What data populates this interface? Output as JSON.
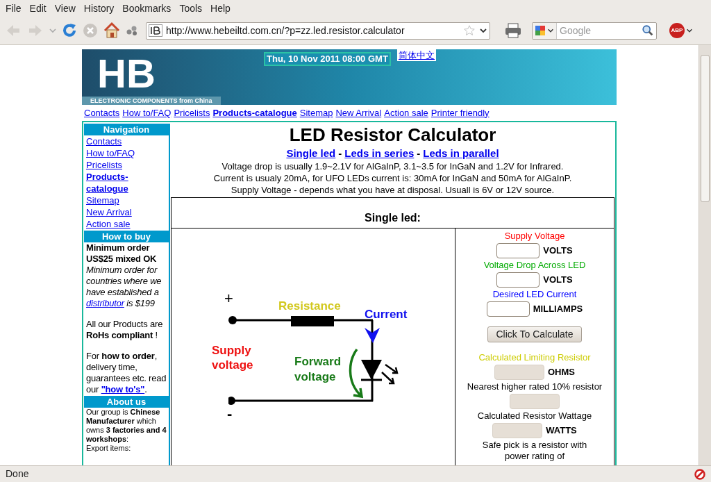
{
  "menu": [
    {
      "label": "File"
    },
    {
      "label": "Edit"
    },
    {
      "label": "View"
    },
    {
      "label": "History"
    },
    {
      "label": "Bookmarks"
    },
    {
      "label": "Tools"
    },
    {
      "label": "Help"
    }
  ],
  "toolbar": {
    "url": "http://www.hebeiltd.com.cn/?p=zz.led.resistor.calculator",
    "search": {
      "placeholder": "Google"
    },
    "adblock_label": "ABP"
  },
  "banner": {
    "logo": "HB",
    "tagline": "ELECTRONIC COMPONENTS from China",
    "date": "Thu, 10 Nov 2011 08:00 GMT",
    "language_link": "简体中文"
  },
  "top_links": [
    {
      "label": "Contacts",
      "bold": false
    },
    {
      "label": "How to/FAQ",
      "bold": false
    },
    {
      "label": "Pricelists",
      "bold": false
    },
    {
      "label": "Products-catalogue",
      "bold": true
    },
    {
      "label": "Sitemap",
      "bold": false
    },
    {
      "label": "New Arrival",
      "bold": false
    },
    {
      "label": "Action sale",
      "bold": false
    },
    {
      "label": "Printer friendly",
      "bold": false
    }
  ],
  "sidebar": {
    "navigation": {
      "title": "Navigation",
      "items": [
        {
          "label": "Contacts",
          "bold": false
        },
        {
          "label": "How to/FAQ",
          "bold": false
        },
        {
          "label": "Pricelists",
          "bold": false
        },
        {
          "label": "Products-catalogue",
          "bold": true
        },
        {
          "label": "Sitemap",
          "bold": false
        },
        {
          "label": "New Arrival",
          "bold": false
        },
        {
          "label": "Action sale",
          "bold": false
        }
      ]
    },
    "how_to_buy": {
      "title": "How to buy",
      "headline": "Minimum order US$25 mixed OK",
      "paragraphs": [
        {
          "before": "Minimum order for countries where we have established a",
          "link": "distributor",
          "after": "is $199",
          "italic": true
        },
        {
          "before": "All our Products are **RoHs compliant** !",
          "italic": false
        },
        {
          "before": "For **how to order**, delivery time, guarantees etc. read our",
          "link": "\"how to's\"",
          "after": ".",
          "italic": false
        }
      ]
    },
    "about_us": {
      "title": "About us",
      "paragraphs": [
        "Our group is **Chinese Manufacturer** which owns **3 factories and 4 workshops**:",
        "Export items:"
      ]
    }
  },
  "calculator": {
    "title": "LED Resistor Calculator",
    "modes": [
      {
        "label": "Single led"
      },
      {
        "label": "Leds in series"
      },
      {
        "label": "Leds in parallel"
      }
    ],
    "separator": "-",
    "notes": [
      "Voltage drop is usually 1.9~2.1V for AlGaInP, 3.1~3.5 for InGaN and 1.2V for Infrared.",
      "Current is usualy 20mA, for UFO LEDs current is: 30mA for InGaN and 50mA for AlGaInP.",
      "Supply Voltage - depends what you have at disposal. Usuall is 6V or 12V source."
    ],
    "section_title": "Single led:",
    "diagram": {
      "plus": "+",
      "minus": "-",
      "resistance": "Resistance",
      "current": "Current",
      "supply": "Supply voltage",
      "forward": "Forward voltage"
    },
    "form": [
      {
        "kind": "input",
        "label": "Supply Voltage",
        "color": "#ff0000",
        "unit": "VOLTS"
      },
      {
        "kind": "input",
        "label": "Voltage Drop Across LED",
        "color": "#00aa00",
        "unit": "VOLTS"
      },
      {
        "kind": "input",
        "label": "Desired LED Current",
        "color": "#0000ff",
        "unit": "MILLIAMPS"
      },
      {
        "kind": "button",
        "label": "Click To Calculate"
      },
      {
        "kind": "output",
        "label": "Calculated Limiting Resistor",
        "color": "#cccc00",
        "unit": "OHMS"
      },
      {
        "kind": "output",
        "label": "Nearest higher rated 10% resistor",
        "color": "#000000"
      },
      {
        "kind": "output",
        "label": "Calculated Resistor Wattage",
        "color": "#000000",
        "unit": "WATTS"
      },
      {
        "kind": "text",
        "label": "Safe pick is a resistor with power rating of",
        "color": "#000000"
      }
    ]
  },
  "status_bar": "Done"
}
